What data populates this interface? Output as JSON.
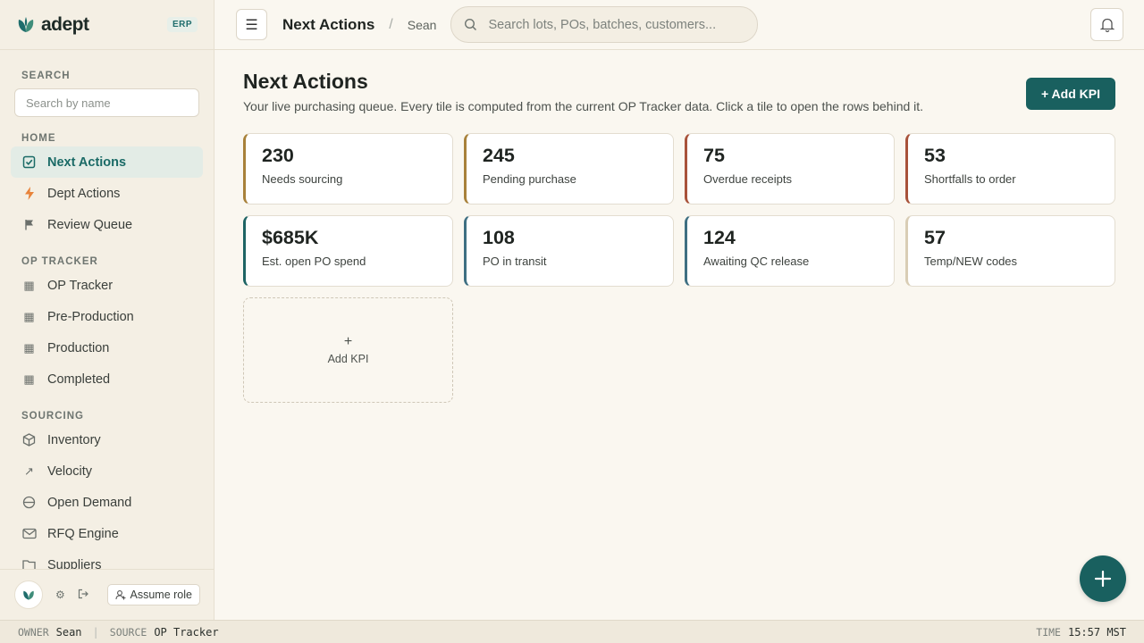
{
  "brand": {
    "name": "adept",
    "badge": "ERP"
  },
  "sidebar": {
    "search_title": "SEARCH",
    "search_placeholder": "Search by name",
    "groups": [
      {
        "title": "HOME",
        "items": [
          {
            "label": "Next Actions",
            "icon": "checkbox-icon",
            "active": true
          },
          {
            "label": "Dept Actions",
            "icon": "bolt-icon"
          },
          {
            "label": "Review Queue",
            "icon": "flag-icon"
          }
        ]
      },
      {
        "title": "OP TRACKER",
        "items": [
          {
            "label": "OP Tracker",
            "icon": "table-icon"
          },
          {
            "label": "Pre-Production",
            "icon": "table-icon"
          },
          {
            "label": "Production",
            "icon": "table-icon"
          },
          {
            "label": "Completed",
            "icon": "table-icon"
          }
        ]
      },
      {
        "title": "SOURCING",
        "items": [
          {
            "label": "Inventory",
            "icon": "cube-icon"
          },
          {
            "label": "Velocity",
            "icon": "trend-icon"
          },
          {
            "label": "Open Demand",
            "icon": "minus-circle-icon"
          },
          {
            "label": "RFQ Engine",
            "icon": "mail-icon"
          },
          {
            "label": "Suppliers",
            "icon": "folder-icon"
          }
        ]
      }
    ],
    "assume_role_label": "Assume role"
  },
  "topbar": {
    "title": "Next Actions",
    "separator": "/",
    "user": "Sean",
    "search_placeholder": "Search lots, POs, batches, customers..."
  },
  "main": {
    "title": "Next Actions",
    "subtitle": "Your live purchasing queue. Every tile is computed from the current OP Tracker data. Click a tile to open the rows behind it.",
    "add_kpi_label": "+ Add KPI",
    "tiles": [
      {
        "value": "230",
        "label": "Needs sourcing",
        "color": "#a8813a"
      },
      {
        "value": "245",
        "label": "Pending purchase",
        "color": "#a8813a"
      },
      {
        "value": "75",
        "label": "Overdue receipts",
        "color": "#a8523a"
      },
      {
        "value": "53",
        "label": "Shortfalls to order",
        "color": "#a8523a"
      },
      {
        "value": "$685K",
        "label": "Est. open PO spend",
        "color": "#1e6464"
      },
      {
        "value": "108",
        "label": "PO in transit",
        "color": "#3e6f82"
      },
      {
        "value": "124",
        "label": "Awaiting QC release",
        "color": "#3e6f82"
      },
      {
        "value": "57",
        "label": "Temp/NEW codes",
        "color": "#d9cdb5"
      }
    ],
    "add_tile": {
      "plus": "+",
      "label": "Add KPI"
    }
  },
  "statusbar": {
    "owner_key": "OWNER",
    "owner": "Sean",
    "source_key": "SOURCE",
    "source": "OP Tracker",
    "time_key": "TIME",
    "time": "15:57 MST"
  }
}
